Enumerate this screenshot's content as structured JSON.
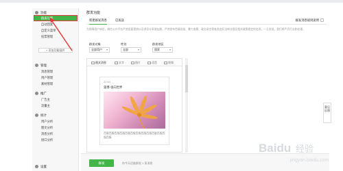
{
  "sidebar": {
    "group1": {
      "title": "功能"
    },
    "items1": [
      {
        "label": "群发功能"
      },
      {
        "label": "自动回复"
      },
      {
        "label": "自定义菜单"
      },
      {
        "label": "投票管理"
      }
    ],
    "add_plugin": "+ 添加功能插件",
    "group2": {
      "title": "管理"
    },
    "items2": [
      {
        "label": "消息管理"
      },
      {
        "label": "用户管理"
      },
      {
        "label": "素材管理"
      }
    ],
    "group3": {
      "title": "推广"
    },
    "items3": [
      {
        "label": "广告主"
      },
      {
        "label": "流量主"
      }
    ],
    "group4": {
      "title": "统计"
    },
    "items4": [
      {
        "label": "用户分析"
      },
      {
        "label": "图文分析"
      },
      {
        "label": "消息分析"
      },
      {
        "label": "接口分析"
      }
    ],
    "group5": {
      "title": "设置"
    }
  },
  "main": {
    "title": "群发功能",
    "tabs": [
      {
        "label": "新建群发消息"
      },
      {
        "label": "已发送"
      }
    ],
    "rules_link": "群发消息规则说明",
    "notice": "为保障用户体验，微信公众平台严禁恶意营销以及诱导分享朋友圈，严禁发布色情低俗、暴力血腥、政治谣言等各类违反法律法规及相关政策规定的信息。一旦发现，我们将严厉打击和处理。",
    "filters": {
      "recipients": {
        "label": "群发对象",
        "value": "全部用户"
      },
      "gender": {
        "label": "性别",
        "value": "全部"
      },
      "region": {
        "label": "群发地区",
        "value": "国家"
      }
    },
    "editor_tabs": [
      "图文消息",
      "文字",
      "图片",
      "语音",
      "视频"
    ],
    "card": {
      "time": "22:54",
      "title": "淄博-张向世界",
      "summary": "西服西服西服西服西服西服西服西服西服西服西服西服西服"
    },
    "send_button": "群发",
    "bottom_note": "你今天还能群发 1 条消息"
  },
  "float_side": "意见反馈",
  "watermark": {
    "text": "Baidu 经验",
    "sub": "jingyan.baidu.com"
  },
  "colors": {
    "accent": "#44b549",
    "highlight": "#e03c3c"
  }
}
